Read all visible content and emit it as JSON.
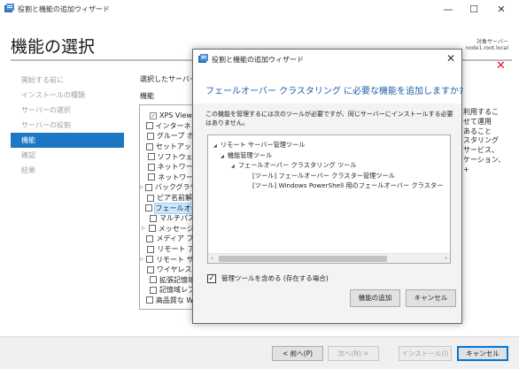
{
  "window": {
    "title": "役割と機能の追加ウィザード",
    "controls": {
      "minimize": "—",
      "maximize": "☐",
      "close": "✕"
    }
  },
  "page": {
    "title": "機能の選択",
    "destination_label": "対象サーバー",
    "destination_value": "node1.root.local"
  },
  "nav": {
    "items": [
      {
        "label": "開始する前に",
        "active": false
      },
      {
        "label": "インストールの種類",
        "active": false
      },
      {
        "label": "サーバーの選択",
        "active": false
      },
      {
        "label": "サーバーの役割",
        "active": false
      },
      {
        "label": "機能",
        "active": true
      },
      {
        "label": "確認",
        "active": false
      },
      {
        "label": "結果",
        "active": false
      }
    ]
  },
  "content": {
    "section_label": "選択したサーバー",
    "features_label": "機能",
    "features": [
      {
        "label": "XPS Viewer",
        "checked": true,
        "expandable": false,
        "selected": false
      },
      {
        "label": "インターネット印刷クライアント",
        "checked": false,
        "expandable": false,
        "selected": false
      },
      {
        "label": "グループ ポリシーの管理",
        "checked": false,
        "expandable": false,
        "selected": false
      },
      {
        "label": "セットアップとブートイベント",
        "checked": false,
        "expandable": false,
        "selected": false
      },
      {
        "label": "ソフトウェア負荷分散",
        "checked": false,
        "expandable": false,
        "selected": false
      },
      {
        "label": "ネットワーク負荷分散",
        "checked": false,
        "expandable": false,
        "selected": false
      },
      {
        "label": "ネットワーク仮想化",
        "checked": false,
        "expandable": false,
        "selected": false
      },
      {
        "label": "バックグラウンド インテリジェント転送サービス",
        "checked": false,
        "expandable": true,
        "selected": false
      },
      {
        "label": "ピア名前解決プロトコル",
        "checked": false,
        "expandable": false,
        "selected": false
      },
      {
        "label": "フェールオーバー クラスタリング",
        "checked": false,
        "expandable": false,
        "selected": true
      },
      {
        "label": "マルチパス I/O",
        "checked": false,
        "expandable": false,
        "selected": false
      },
      {
        "label": "メッセージ キュー",
        "checked": false,
        "expandable": true,
        "selected": false
      },
      {
        "label": "メディア ファンデーション",
        "checked": false,
        "expandable": false,
        "selected": false
      },
      {
        "label": "リモート アシスタンス",
        "checked": false,
        "expandable": false,
        "selected": false
      },
      {
        "label": "リモート サーバー管理ツール",
        "checked": false,
        "expandable": true,
        "selected": false
      },
      {
        "label": "ワイヤレス LAN サービス",
        "checked": false,
        "expandable": false,
        "selected": false
      },
      {
        "label": "拡張記憶域",
        "checked": false,
        "expandable": false,
        "selected": false
      },
      {
        "label": "記憶域レプリカ",
        "checked": false,
        "expandable": false,
        "selected": false
      },
      {
        "label": "高品質な Windows オーディオ",
        "checked": false,
        "expandable": false,
        "selected": false
      }
    ],
    "description_lines": [
      "利用するこ",
      "せて運用",
      "あること",
      "スタリング",
      "サービス、",
      "ケーション、",
      "+"
    ]
  },
  "footer": {
    "prev": "< 前へ(P)",
    "next": "次へ(N) >",
    "install": "インストール(I)",
    "cancel": "キャンセル"
  },
  "dialog": {
    "title": "役割と機能の追加ウィザード",
    "close": "✕",
    "heading": "フェールオーバー クラスタリング に必要な機能を追加しますか?",
    "message": "この機能を管理するには次のツールが必要ですが、同じサーバーにインストールする必要はありません。",
    "tree": [
      {
        "label": "リモート サーバー管理ツール",
        "level": 0,
        "expander": true
      },
      {
        "label": "機能管理ツール",
        "level": 1,
        "expander": true
      },
      {
        "label": "フェールオーバー クラスタリング ツール",
        "level": 2,
        "expander": true
      },
      {
        "label": "[ツール] フェールオーバー クラスター管理ツール",
        "level": 3,
        "expander": false
      },
      {
        "label": "[ツール] Windows PowerShell 用のフェールオーバー クラスター",
        "level": 3,
        "expander": false
      }
    ],
    "include_tools_label": "管理ツールを含める (存在する場合)",
    "include_tools_checked": true,
    "add_button": "機能の追加",
    "cancel_button": "キャンセル"
  },
  "colors": {
    "accent": "#1c78c4",
    "heading": "#1f5fa8",
    "close_red": "#e81123",
    "selection": "#cce8ff"
  }
}
